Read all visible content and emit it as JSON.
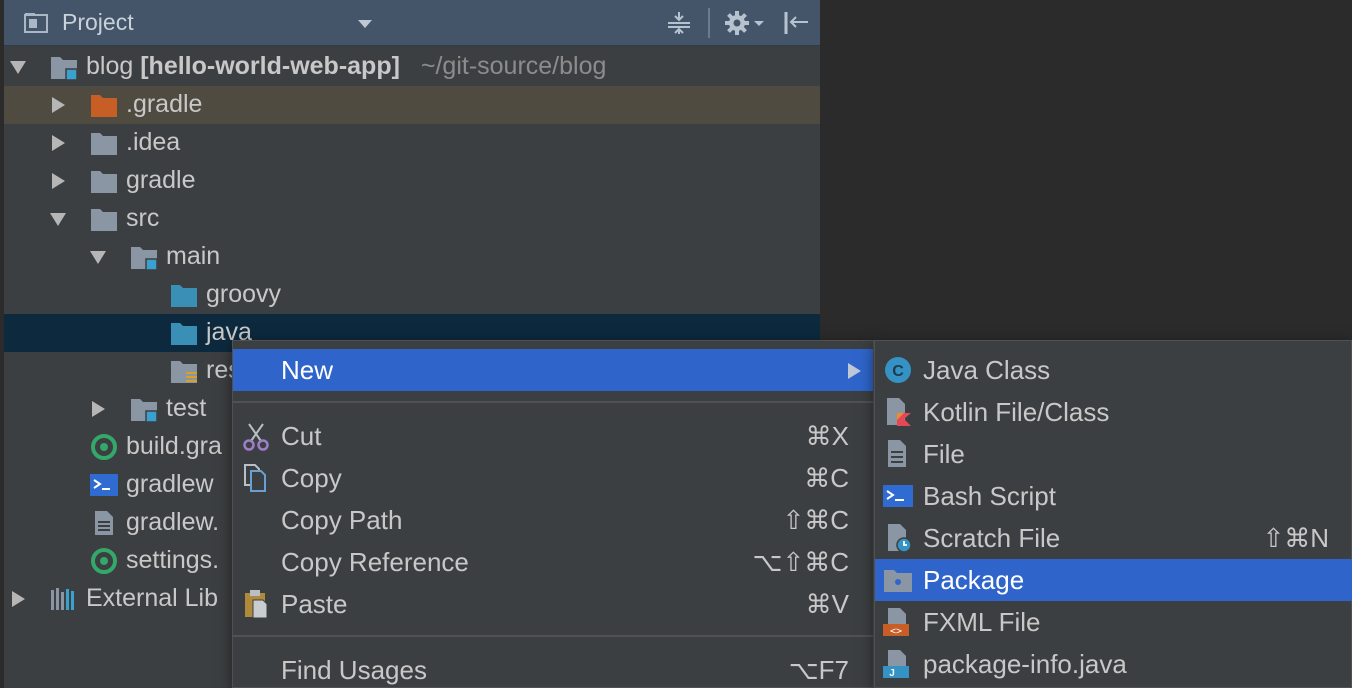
{
  "panel": {
    "title": "Project",
    "icon": "project-view-icon",
    "buttons": [
      "collapse-all-icon",
      "gear-icon",
      "hide-panel-icon"
    ]
  },
  "tree": {
    "root": {
      "name": "blog",
      "module": "[hello-world-web-app]",
      "path": "~/git-source/blog"
    },
    "items": [
      {
        "label": ".gradle",
        "icon": "folder-excluded-icon"
      },
      {
        "label": ".idea",
        "icon": "folder-icon"
      },
      {
        "label": "gradle",
        "icon": "folder-icon"
      },
      {
        "label": "src",
        "icon": "folder-icon"
      },
      {
        "label": "main",
        "icon": "module-folder-icon"
      },
      {
        "label": "groovy",
        "icon": "source-folder-icon"
      },
      {
        "label": "java",
        "icon": "source-folder-icon"
      },
      {
        "label": "resou",
        "icon": "resources-folder-icon"
      },
      {
        "label": "test",
        "icon": "module-folder-icon"
      },
      {
        "label": "build.gra",
        "icon": "gradle-icon"
      },
      {
        "label": "gradlew",
        "icon": "shell-script-icon"
      },
      {
        "label": "gradlew.",
        "icon": "text-file-icon"
      },
      {
        "label": "settings.",
        "icon": "gradle-icon"
      },
      {
        "label": "External Lib",
        "icon": "libraries-icon"
      }
    ]
  },
  "context_menu": {
    "new": {
      "label": "New"
    },
    "items": [
      {
        "label": "Cut",
        "shortcut": "⌘X",
        "icon": "scissors-icon"
      },
      {
        "label": "Copy",
        "shortcut": "⌘C",
        "icon": "copy-icon"
      },
      {
        "label": "Copy Path",
        "shortcut": "⇧⌘C"
      },
      {
        "label": "Copy Reference",
        "shortcut": "⌥⇧⌘C"
      },
      {
        "label": "Paste",
        "shortcut": "⌘V",
        "icon": "paste-icon"
      }
    ],
    "find_usages": {
      "label": "Find Usages",
      "shortcut": "⌥F7"
    }
  },
  "submenu": {
    "items": [
      {
        "label": "Java Class",
        "icon": "java-class-icon"
      },
      {
        "label": "Kotlin File/Class",
        "icon": "kotlin-file-icon"
      },
      {
        "label": "File",
        "icon": "file-icon"
      },
      {
        "label": "Bash Script",
        "icon": "bash-script-icon"
      },
      {
        "label": "Scratch File",
        "shortcut": "⇧⌘N",
        "icon": "scratch-file-icon"
      },
      {
        "label": "Package",
        "icon": "package-icon"
      },
      {
        "label": "FXML File",
        "icon": "fxml-file-icon"
      },
      {
        "label": "package-info.java",
        "icon": "package-info-icon"
      }
    ]
  },
  "colors": {
    "highlight": "#2f65ca",
    "selected_row": "#0d293e",
    "excluded_row": "#4f4b41",
    "header": "#44556a"
  }
}
